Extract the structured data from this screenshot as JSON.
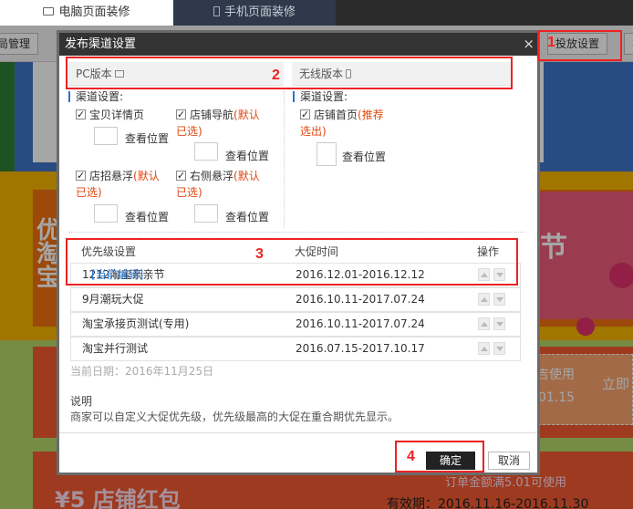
{
  "top_tabs": {
    "pc": "电脑页面装修",
    "mobile": "手机页面装修"
  },
  "toolbar": {
    "layout_mgmt": "局管理",
    "deliver_settings": "投放设置",
    "more": "与"
  },
  "background": {
    "promo_side": "优\n淘\n宝",
    "big_char": "节",
    "use_text": "吉使用",
    "date_fragment": "01.15",
    "receive_now": "立即",
    "red_packet": "¥5 店铺红包",
    "order_text": "订单金额满5.01可使用",
    "validity": "有效期：2016.11.16-2016.11.30"
  },
  "dialog": {
    "title": "发布渠道设置",
    "close": "×",
    "pc_version": "PC版本",
    "wireless_version": "无线版本",
    "pc_section": "渠道设置:",
    "wl_section": "渠道设置:",
    "pc_items": [
      {
        "label": "宝贝详情页",
        "default": "",
        "checked": true
      },
      {
        "label": "店铺导航",
        "default": "(默认",
        "default2": "已选)",
        "checked": true
      },
      {
        "label": "店招悬浮",
        "default": "(默认",
        "default2": "已选)",
        "checked": true
      },
      {
        "label": "右侧悬浮",
        "default": "(默认",
        "default2": "已选)",
        "checked": true
      }
    ],
    "wl_items": [
      {
        "label": "店铺首页",
        "default": "(推荐",
        "default2": "选出)",
        "checked": true
      }
    ],
    "view_position": "查看位置",
    "table": {
      "headers": [
        "优先级设置",
        "大促时间",
        "操作"
      ],
      "rows": [
        {
          "name": "1212淘宝亲亲节",
          "edit": "[当前编辑]",
          "time": "2016.12.01-2016.12.12"
        },
        {
          "name": "9月潮玩大促",
          "edit": "",
          "time": "2016.10.11-2017.07.24"
        },
        {
          "name": "淘宝承接页测试(专用)",
          "edit": "",
          "time": "2016.10.11-2017.07.24"
        },
        {
          "name": "淘宝并行测试",
          "edit": "",
          "time": "2016.07.15-2017.10.17"
        }
      ]
    },
    "current_date": "当前日期：2016年11月25日",
    "note_title": "说明",
    "note_text": "商家可以自定义大促优先级，优先级最高的大促在重合期优先显示。",
    "ok": "确定",
    "cancel": "取消"
  },
  "annotations": [
    "1",
    "2",
    "3",
    "4"
  ],
  "colors": {
    "highlight": "#e22222",
    "link": "#2b73c9",
    "accent_red": "#e0470f",
    "dialog_header": "#333333"
  }
}
